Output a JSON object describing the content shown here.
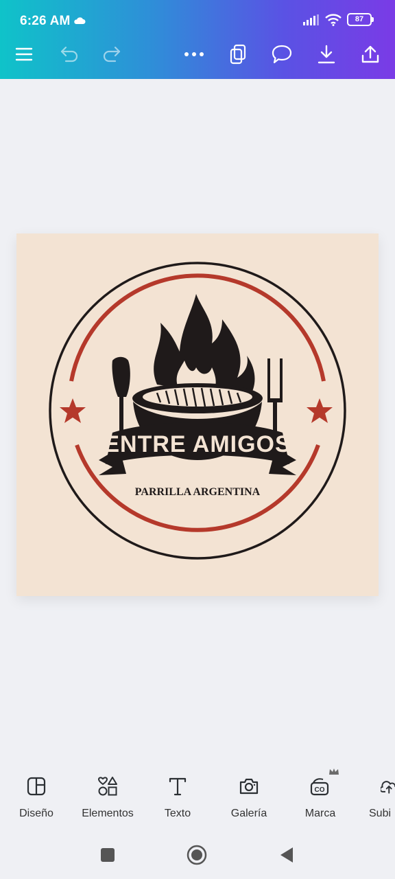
{
  "status_bar": {
    "time": "6:26 AM",
    "battery": "87"
  },
  "toolbar": {
    "icons": [
      "menu-icon",
      "undo-icon",
      "redo-icon",
      "more-icon",
      "pages-icon",
      "comment-icon",
      "download-icon",
      "share-icon"
    ]
  },
  "design": {
    "logo_title": "ENTRE AMIGOS",
    "logo_subtitle": "PARRILLA ARGENTINA",
    "colors": {
      "background": "#f3e3d3",
      "dark": "#1f1a1a",
      "red": "#b5392b"
    }
  },
  "bottom_tools": [
    {
      "label": "Diseño",
      "icon": "layout-icon"
    },
    {
      "label": "Elementos",
      "icon": "shapes-icon"
    },
    {
      "label": "Texto",
      "icon": "text-icon"
    },
    {
      "label": "Galería",
      "icon": "camera-icon"
    },
    {
      "label": "Marca",
      "icon": "brand-icon"
    },
    {
      "label": "Subi",
      "icon": "upload-cloud-icon"
    }
  ],
  "colors": {
    "gradient_start": "#0fc3c9",
    "gradient_end": "#7a3be6",
    "page_background": "#eff0f4"
  }
}
